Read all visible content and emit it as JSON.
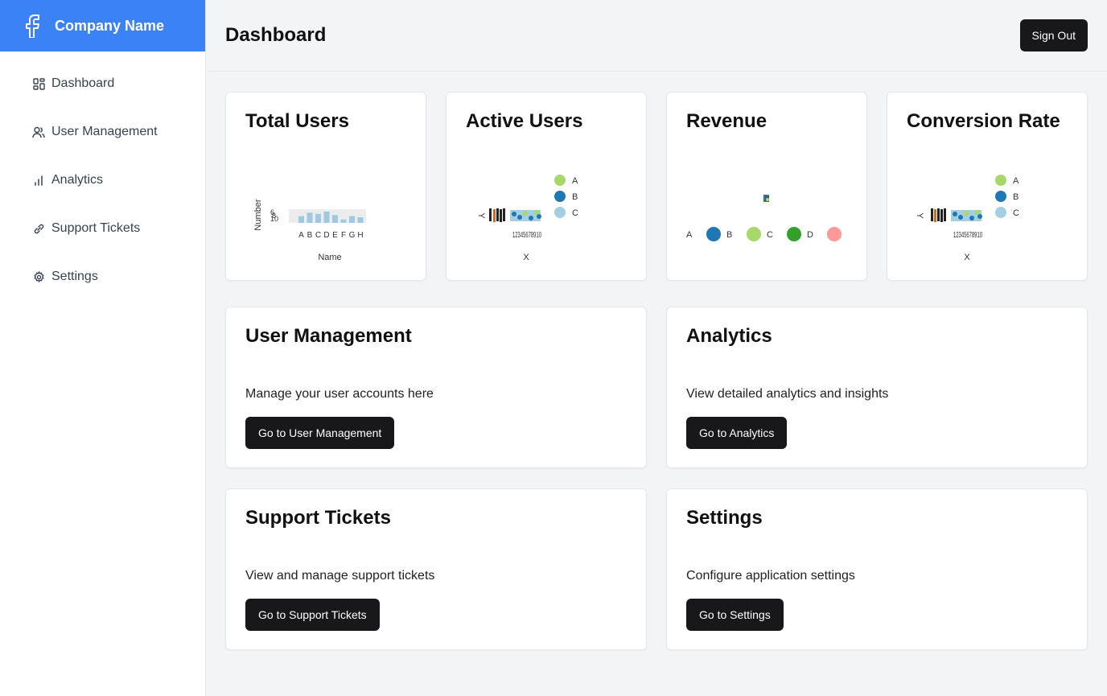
{
  "brand": {
    "name": "Company Name",
    "logo_icon": "facebook-icon",
    "color": "#3b82f6"
  },
  "sidebar": {
    "items": [
      {
        "label": "Dashboard",
        "icon": "dashboard-grid-icon"
      },
      {
        "label": "User Management",
        "icon": "users-icon"
      },
      {
        "label": "Analytics",
        "icon": "bar-chart-icon"
      },
      {
        "label": "Support Tickets",
        "icon": "ticket-link-icon"
      },
      {
        "label": "Settings",
        "icon": "gear-icon"
      }
    ]
  },
  "header": {
    "title": "Dashboard",
    "signout_label": "Sign Out"
  },
  "stats": [
    {
      "title": "Total Users"
    },
    {
      "title": "Active Users"
    },
    {
      "title": "Revenue"
    },
    {
      "title": "Conversion Rate"
    }
  ],
  "sections": [
    {
      "title": "User Management",
      "description": "Manage your user accounts here",
      "button": "Go to User Management"
    },
    {
      "title": "Analytics",
      "description": "View detailed analytics and insights",
      "button": "Go to Analytics"
    },
    {
      "title": "Support Tickets",
      "description": "View and manage support tickets",
      "button": "Go to Support Tickets"
    },
    {
      "title": "Settings",
      "description": "Configure application settings",
      "button": "Go to Settings"
    }
  ],
  "chart_data": [
    {
      "type": "bar",
      "xlabel": "Name",
      "ylabel": "Number",
      "categories": [
        "A",
        "B",
        "C",
        "D",
        "E",
        "F",
        "G",
        "H"
      ],
      "values": [
        6,
        9,
        8,
        10,
        7,
        3,
        6,
        5
      ],
      "colors": {
        "bar": "#9ecae1"
      }
    },
    {
      "type": "scatter",
      "xlabel": "X",
      "ylabel": "Y",
      "x_ticks": [
        "12345678910"
      ],
      "legend": [
        "A",
        "B",
        "C"
      ],
      "legend_position": "right",
      "colors": {
        "A": "#a6d96a",
        "B": "#1f78b4",
        "C": "#a6cee3"
      }
    },
    {
      "type": "scatter",
      "legend": [
        "A",
        "B",
        "C",
        "D"
      ],
      "legend_position": "bottom",
      "colors": {
        "A": "#1f78b4",
        "B": "#a6d96a",
        "C": "#33a02c",
        "D": "#fb9a99"
      }
    },
    {
      "type": "scatter",
      "xlabel": "X",
      "ylabel": "Y",
      "x_ticks": [
        "12345678910"
      ],
      "legend": [
        "A",
        "B",
        "C"
      ],
      "legend_position": "right",
      "colors": {
        "A": "#a6d96a",
        "B": "#1f78b4",
        "C": "#a6cee3"
      }
    }
  ]
}
